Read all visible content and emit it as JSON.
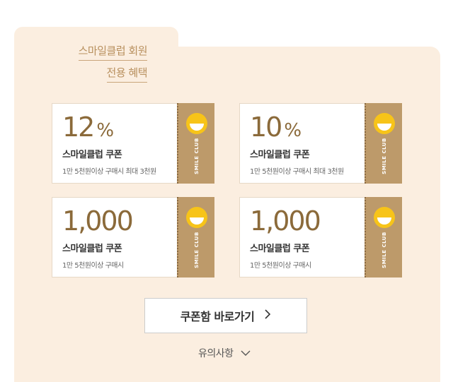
{
  "heading": {
    "line1": "스마일클럽 회원",
    "line2": "전용 혜택"
  },
  "coupons": [
    {
      "value": "12",
      "unit": "%",
      "title": "스마일클럽 쿠폰",
      "condition": "1만 5천원이상 구매시 최대 3천원",
      "stub_label": "SMILE CLUB"
    },
    {
      "value": "10",
      "unit": "%",
      "title": "스마일클럽 쿠폰",
      "condition": "1만 5천원이상 구매시 최대 3천원",
      "stub_label": "SMILE CLUB"
    },
    {
      "value": "1,000",
      "unit": "",
      "title": "스마일클럽 쿠폰",
      "condition": "1만 5천원이상 구매시",
      "stub_label": "SMILE CLUB"
    },
    {
      "value": "1,000",
      "unit": "",
      "title": "스마일클럽 쿠폰",
      "condition": "1만 5천원이상 구매시",
      "stub_label": "SMILE CLUB"
    }
  ],
  "coupon_box_button": {
    "label": "쿠폰함 바로가기",
    "icon": "chevron-right-icon"
  },
  "notice": {
    "label": "유의사항",
    "icon": "chevron-down-icon"
  },
  "colors": {
    "panel": "#fbeee0",
    "accent": "#b8905e",
    "stub": "#bd9a6a",
    "smile": "#f7c419"
  }
}
